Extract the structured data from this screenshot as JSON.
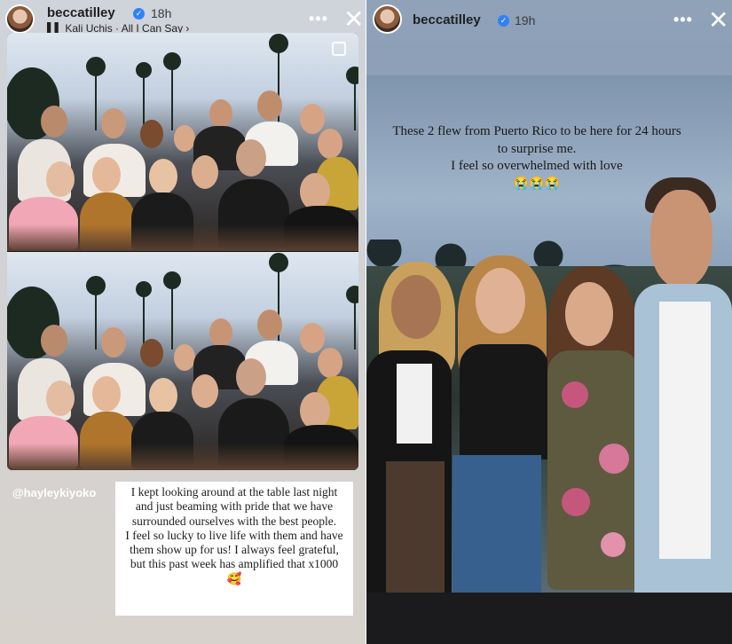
{
  "left_story": {
    "username": "beccatilley",
    "time": "18h",
    "music": "Kali Uchis · All I Can Say",
    "mention": "@hayleykiyoko",
    "caption": "I kept looking around at the table last night and just beaming with pride that we have surrounded ourselves with the best people.\nI feel so lucky to live life with them and have them show up for us! I always feel grateful, but this past week has amplified that x1000 🥰"
  },
  "right_story": {
    "username": "beccatilley",
    "time": "19h",
    "text": "These 2 flew from Puerto Rico to be here for 24 hours to surprise me.\nI feel so overwhelmed with love",
    "emoji": "😭😭😭"
  },
  "icons": {
    "more": "more-horizontal-icon",
    "close": "close-icon",
    "verified": "verified-badge-icon",
    "music": "music-icon"
  },
  "colors": {
    "verified": "#2f82f5",
    "caption_bg": "#ffffff"
  }
}
